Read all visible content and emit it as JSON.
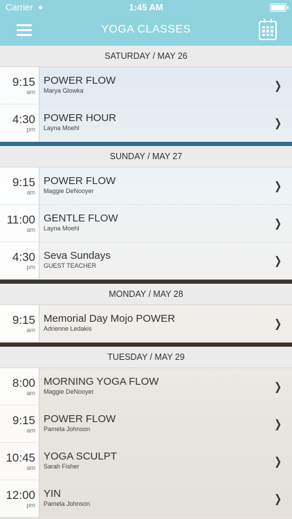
{
  "status_bar": {
    "carrier": "Carrier",
    "time": "1:45 AM"
  },
  "navbar": {
    "title": "YOGA CLASSES"
  },
  "colors": {
    "nav_bg": "#8fd3df",
    "header_bg": "#ebebeb"
  },
  "icons": {
    "menu": "hamburger-menu-icon",
    "calendar": "calendar-icon",
    "row_action": "chevron-right-icon"
  },
  "days": [
    {
      "header": "SATURDAY / MAY 26",
      "classes": [
        {
          "time": "9:15",
          "ampm": "am",
          "name": "POWER FLOW",
          "teacher": "Marya Glowka"
        },
        {
          "time": "4:30",
          "ampm": "pm",
          "name": "POWER HOUR",
          "teacher": "Layna Moehl"
        }
      ]
    },
    {
      "header": "SUNDAY / MAY 27",
      "classes": [
        {
          "time": "9:15",
          "ampm": "am",
          "name": "POWER FLOW",
          "teacher": "Maggie DeNooyer"
        },
        {
          "time": "11:00",
          "ampm": "am",
          "name": "GENTLE FLOW",
          "teacher": "Layna Moehl"
        },
        {
          "time": "4:30",
          "ampm": "pm",
          "name": "Seva Sundays",
          "teacher": "GUEST TEACHER"
        }
      ]
    },
    {
      "header": "MONDAY / MAY 28",
      "classes": [
        {
          "time": "9:15",
          "ampm": "am",
          "name": "Memorial  Day Mojo POWER",
          "teacher": "Adrienne Ledakis"
        }
      ]
    },
    {
      "header": "TUESDAY / MAY 29",
      "classes": [
        {
          "time": "8:00",
          "ampm": "am",
          "name": "MORNING YOGA FLOW",
          "teacher": "Maggie DeNooyer"
        },
        {
          "time": "9:15",
          "ampm": "am",
          "name": "POWER FLOW",
          "teacher": "Pamela Johnson"
        },
        {
          "time": "10:45",
          "ampm": "am",
          "name": "YOGA SCULPT",
          "teacher": "Sarah Fisher"
        },
        {
          "time": "12:00",
          "ampm": "pm",
          "name": "YIN",
          "teacher": "Pamela Johnson"
        }
      ]
    }
  ]
}
